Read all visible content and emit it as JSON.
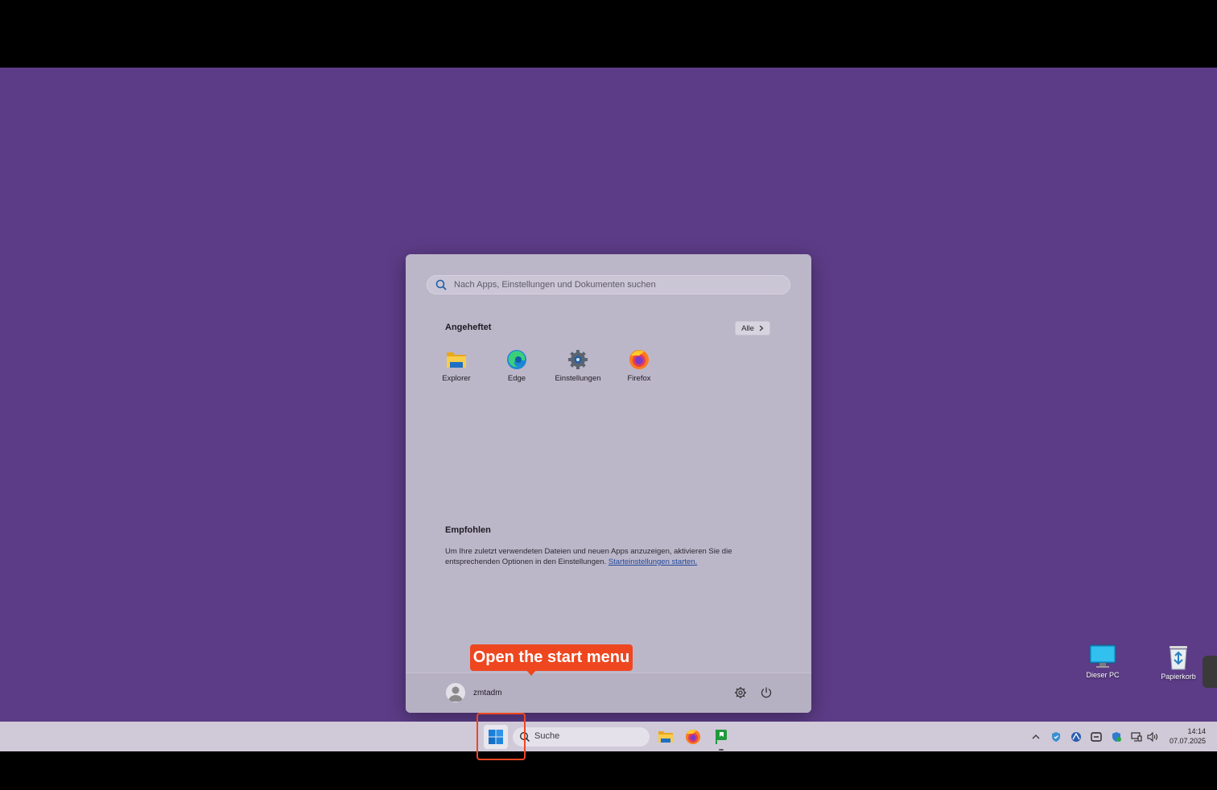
{
  "start_menu": {
    "search_placeholder": "Nach Apps, Einstellungen und Dokumenten suchen",
    "pinned_title": "Angeheftet",
    "all_button": "Alle",
    "pinned_apps": [
      {
        "label": "Explorer",
        "icon": "file-explorer-icon"
      },
      {
        "label": "Edge",
        "icon": "edge-icon"
      },
      {
        "label": "Einstellungen",
        "icon": "settings-gear-icon"
      },
      {
        "label": "Firefox",
        "icon": "firefox-icon"
      }
    ],
    "recommended_title": "Empfohlen",
    "recommended_text": "Um Ihre zuletzt verwendeten Dateien und neuen Apps anzuzeigen, aktivieren Sie die entsprechenden Optionen in den Einstellungen.",
    "recommended_link": "Starteinstellungen starten.",
    "user_name": "zmtadm"
  },
  "tooltip": {
    "text": "Open the start menu",
    "color": "#ee4720"
  },
  "desktop": {
    "background_color": "#5c3c87",
    "icons": [
      {
        "label": "Dieser PC",
        "icon": "monitor-icon"
      },
      {
        "label": "Papierkorb",
        "icon": "recycle-bin-icon"
      }
    ]
  },
  "taskbar": {
    "search_placeholder": "Suche",
    "apps": [
      "file-explorer-icon",
      "firefox-icon",
      "green-flag-app-icon"
    ],
    "tray_icons": [
      "chevron-up-icon",
      "security-shield-icon",
      "network-app-icon",
      "remote-desktop-icon",
      "defender-icon",
      "display-icon",
      "volume-icon"
    ],
    "time": "14:14",
    "date": "07.07.2025"
  }
}
